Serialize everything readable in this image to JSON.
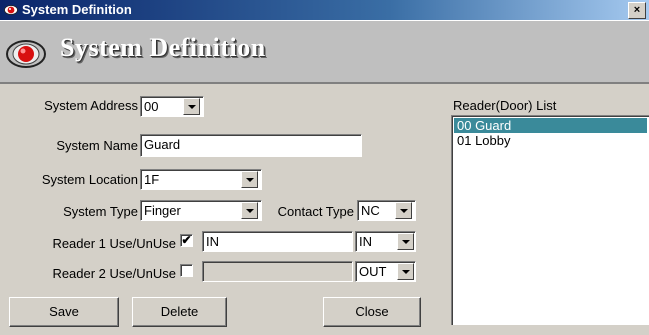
{
  "window": {
    "title": "System Definition",
    "close_glyph": "×"
  },
  "banner": {
    "title": "System Definition"
  },
  "form": {
    "system_address": {
      "label": "System Address",
      "value": "00"
    },
    "system_name": {
      "label": "System Name",
      "value": "Guard"
    },
    "system_location": {
      "label": "System Location",
      "value": "1F"
    },
    "system_type": {
      "label": "System Type",
      "value": "Finger"
    },
    "contact_type": {
      "label": "Contact Type",
      "value": "NC"
    },
    "reader1": {
      "label": "Reader 1 Use/UnUse",
      "checked": true,
      "check_mark": "✔",
      "name": "IN",
      "direction": "IN"
    },
    "reader2": {
      "label": "Reader 2 Use/UnUse",
      "checked": false,
      "check_mark": "",
      "name": "",
      "direction": "OUT"
    }
  },
  "reader_list": {
    "label": "Reader(Door) List",
    "items": [
      {
        "text": "00 Guard",
        "selected": true
      },
      {
        "text": "01 Lobby",
        "selected": false
      }
    ]
  },
  "buttons": {
    "save": "Save",
    "delete": "Delete",
    "close": "Close"
  },
  "icon_names": {
    "window": "red-eye-icon",
    "banner": "red-eye-icon"
  }
}
